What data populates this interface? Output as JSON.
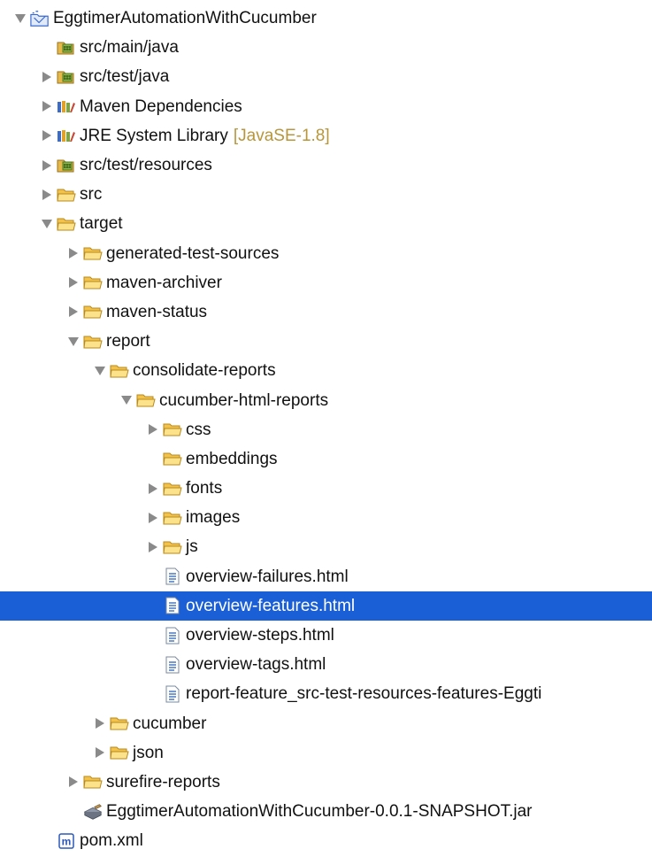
{
  "tree": {
    "items": [
      {
        "label": "EggtimerAutomationWithCucumber",
        "icon": "project-icon",
        "depth": 0,
        "expander": "expanded"
      },
      {
        "label": "src/main/java",
        "icon": "source-folder-icon",
        "depth": 1,
        "expander": "none"
      },
      {
        "label": "src/test/java",
        "icon": "source-folder-icon",
        "depth": 1,
        "expander": "collapsed"
      },
      {
        "label": "Maven Dependencies",
        "icon": "library-icon",
        "depth": 1,
        "expander": "collapsed"
      },
      {
        "label": "JRE System Library",
        "decoration": "[JavaSE-1.8]",
        "icon": "library-icon",
        "depth": 1,
        "expander": "collapsed"
      },
      {
        "label": "src/test/resources",
        "icon": "source-folder-icon",
        "depth": 1,
        "expander": "collapsed"
      },
      {
        "label": "src",
        "icon": "folder-icon",
        "depth": 1,
        "expander": "collapsed"
      },
      {
        "label": "target",
        "icon": "folder-icon",
        "depth": 1,
        "expander": "expanded"
      },
      {
        "label": "generated-test-sources",
        "icon": "folder-icon",
        "depth": 2,
        "expander": "collapsed"
      },
      {
        "label": "maven-archiver",
        "icon": "folder-icon",
        "depth": 2,
        "expander": "collapsed"
      },
      {
        "label": "maven-status",
        "icon": "folder-icon",
        "depth": 2,
        "expander": "collapsed"
      },
      {
        "label": "report",
        "icon": "folder-icon",
        "depth": 2,
        "expander": "expanded"
      },
      {
        "label": "consolidate-reports",
        "icon": "folder-icon",
        "depth": 3,
        "expander": "expanded"
      },
      {
        "label": "cucumber-html-reports",
        "icon": "folder-icon",
        "depth": 4,
        "expander": "expanded"
      },
      {
        "label": "css",
        "icon": "folder-icon",
        "depth": 5,
        "expander": "collapsed"
      },
      {
        "label": "embeddings",
        "icon": "folder-icon",
        "depth": 5,
        "expander": "none"
      },
      {
        "label": "fonts",
        "icon": "folder-icon",
        "depth": 5,
        "expander": "collapsed"
      },
      {
        "label": "images",
        "icon": "folder-icon",
        "depth": 5,
        "expander": "collapsed"
      },
      {
        "label": "js",
        "icon": "folder-icon",
        "depth": 5,
        "expander": "collapsed"
      },
      {
        "label": "overview-failures.html",
        "icon": "html-file-icon",
        "depth": 5,
        "expander": "none"
      },
      {
        "label": "overview-features.html",
        "icon": "html-file-icon",
        "depth": 5,
        "expander": "none",
        "selected": true
      },
      {
        "label": "overview-steps.html",
        "icon": "html-file-icon",
        "depth": 5,
        "expander": "none"
      },
      {
        "label": "overview-tags.html",
        "icon": "html-file-icon",
        "depth": 5,
        "expander": "none"
      },
      {
        "label": "report-feature_src-test-resources-features-Eggti",
        "icon": "html-file-icon",
        "depth": 5,
        "expander": "none"
      },
      {
        "label": "cucumber",
        "icon": "folder-icon",
        "depth": 3,
        "expander": "collapsed"
      },
      {
        "label": "json",
        "icon": "folder-icon",
        "depth": 3,
        "expander": "collapsed"
      },
      {
        "label": "surefire-reports",
        "icon": "folder-icon",
        "depth": 2,
        "expander": "collapsed"
      },
      {
        "label": "EggtimerAutomationWithCucumber-0.0.1-SNAPSHOT.jar",
        "icon": "jar-file-icon",
        "depth": 2,
        "expander": "none"
      },
      {
        "label": "pom.xml",
        "icon": "maven-pom-icon",
        "depth": 1,
        "expander": "none"
      }
    ]
  },
  "colors": {
    "selection": "#1b5fd6",
    "folder": "#f5c84c",
    "expander": "#8a8a8a",
    "decoration": "#b8963a"
  }
}
